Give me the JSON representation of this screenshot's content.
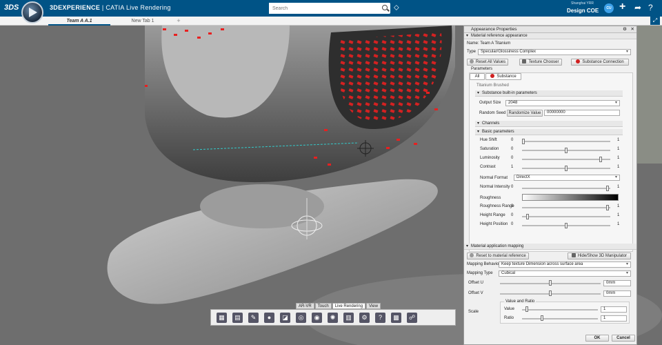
{
  "app": {
    "brand_strong": "3DEXPERIENCE",
    "brand_rest": " | CATIA Live Rendering",
    "search_placeholder": "Search",
    "user_small": "Shanghai YRR",
    "user_main": "Design COE",
    "avatar_text": "CU"
  },
  "tabs": [
    {
      "label": "Team A A.1"
    },
    {
      "label": "New Tab 1"
    },
    {
      "label": "+"
    }
  ],
  "panel": {
    "title": "Appearance Properties",
    "material_section": "Material reference appearance",
    "name_label": "Name:",
    "name_value": "Team A Titanium",
    "type_label": "Type",
    "type_value": "Specular/Glossiness Complex",
    "reset_all": "Reset All Values",
    "texture_chooser": "Texture Chooser",
    "substance_connection": "Substance Connection",
    "parameters_label": "Parameters",
    "subtab_all": "All",
    "subtab_substance": "Substance",
    "substance_name": "Titanium Brushed",
    "builtin_section": "Substance built-in parameters",
    "output_size_label": "Output Size",
    "output_size_value": "2048",
    "random_seed_label": "Random Seed",
    "randomize_button": "Randomize Value",
    "random_seed_value": "00000000",
    "channels_section": "Channels",
    "basic_section": "Basic parameters",
    "sliders": [
      {
        "label": "Hue Shift",
        "lo": "0",
        "hi": "1",
        "value": 0.0
      },
      {
        "label": "Saturation",
        "lo": "0",
        "hi": "1",
        "value": 0.5
      },
      {
        "label": "Luminosity",
        "lo": "0",
        "hi": "1",
        "value": 0.9
      },
      {
        "label": "Contrast",
        "lo": "1",
        "hi": "1",
        "value": 0.5
      }
    ],
    "normal_format_label": "Normal Format",
    "normal_format_value": "DirectX",
    "sliders2": [
      {
        "label": "Normal Intensity",
        "lo": "0",
        "hi": "1",
        "value": 0.98
      }
    ],
    "roughness_label": "Roughness",
    "sliders3": [
      {
        "label": "Roughness Range",
        "lo": "0",
        "hi": "1",
        "value": 0.98
      },
      {
        "label": "Height Range",
        "lo": "0",
        "hi": "1",
        "value": 0.05
      },
      {
        "label": "Height Position",
        "lo": "0",
        "hi": "1",
        "value": 0.5
      }
    ],
    "mapping_section": "Material application mapping",
    "reset_to_ref": "Reset to material reference",
    "hide_show": "Hide/Show 3D Manipulator",
    "mapping_behavior_label": "Mapping Behavio",
    "mapping_behavior_value": "Keep texture Dimension across surface area",
    "mapping_type_label": "Mapping Type",
    "mapping_type_value": "Cubical",
    "offset_u_label": "Offset U",
    "offset_u_value": "0mm",
    "offset_u_pos": 0.5,
    "offset_v_label": "Offset V",
    "offset_v_value": "0mm",
    "offset_v_pos": 0.5,
    "scale_label": "Scale",
    "value_ratio_label": "Value and Ratio",
    "scale_value_label": "Value",
    "scale_value": "1",
    "scale_value_pos": 0.05,
    "scale_ratio_label": "Ratio",
    "scale_ratio": "1",
    "scale_ratio_pos": 0.25,
    "ok": "OK",
    "cancel": "Cancel"
  },
  "toolbar": {
    "tabs": [
      "AR-VR",
      "Touch",
      "Live Rendering",
      "View"
    ],
    "active_tab": "Live Rendering"
  },
  "colors": {
    "accent": "#005386",
    "highlight_red": "#e82020"
  }
}
